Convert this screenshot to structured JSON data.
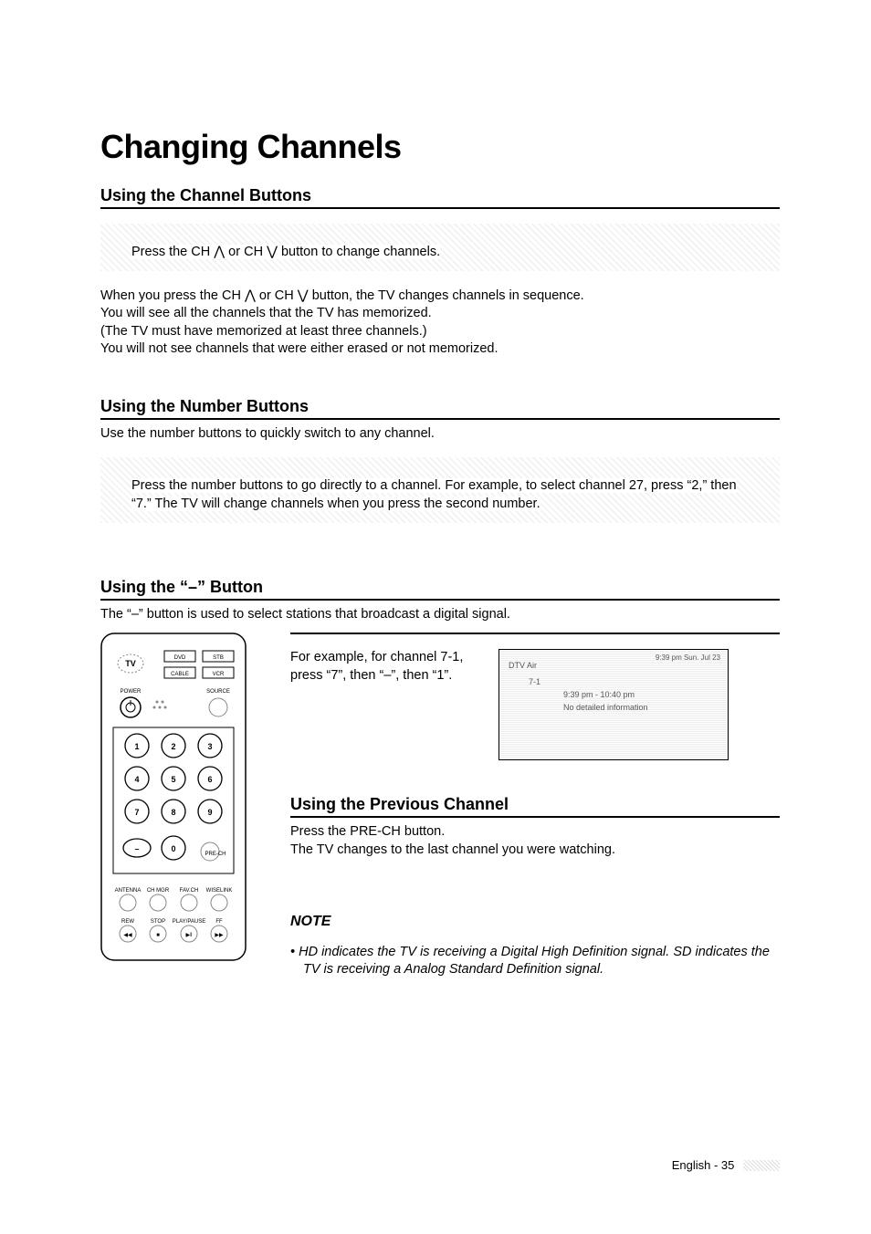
{
  "title": "Changing Channels",
  "sections": {
    "channel_buttons": {
      "heading": "Using the Channel Buttons",
      "callout": "Press the CH  ⋀  or CH  ⋁  button to change channels.",
      "body": "When you press the CH  ⋀  or CH  ⋁  button, the TV changes channels in sequence.\nYou will see all the channels that the TV has memorized.\n(The TV must have memorized at least three channels.)\nYou will not see channels that were either erased or not memorized."
    },
    "number_buttons": {
      "heading": "Using the Number Buttons",
      "intro": "Use the number buttons to quickly switch to any channel.",
      "callout": "Press the number buttons to go directly to a channel. For example, to select channel 27, press “2,” then “7.” The TV will change channels when you press the second number."
    },
    "dash_button": {
      "heading": "Using the “–” Button",
      "intro": "The “–” button is used to select stations that broadcast a digital signal.",
      "example": "For example, for channel 7-1, press “7”, then “–”, then “1”."
    },
    "previous_channel": {
      "heading": "Using the Previous Channel",
      "body": "Press the PRE-CH button.\nThe TV changes to the last channel you were watching."
    },
    "note": {
      "heading": "NOTE",
      "body": "HD indicates the TV is receiving a Digital High Definition signal. SD indicates the TV is receiving a Analog Standard Definition signal."
    }
  },
  "osd": {
    "source": "DTV Air",
    "channel": "7-1",
    "clock": "9:39 pm Sun. Jul 23",
    "slot": "9:39 pm - 10:40 pm",
    "info": "No detailed information"
  },
  "remote": {
    "mode_buttons": [
      "TV",
      "DVD",
      "STB",
      "CABLE",
      "VCR"
    ],
    "power": "POWER",
    "source": "SOURCE",
    "keypad": [
      "1",
      "2",
      "3",
      "4",
      "5",
      "6",
      "7",
      "8",
      "9",
      "–",
      "0",
      ""
    ],
    "prech": "PRE-CH",
    "row1": [
      "ANTENNA",
      "CH MGR",
      "FAV.CH",
      "WISELINK"
    ],
    "row2": [
      "REW",
      "STOP",
      "PLAY/PAUSE",
      "FF"
    ]
  },
  "footer": {
    "label": "English - 35"
  }
}
